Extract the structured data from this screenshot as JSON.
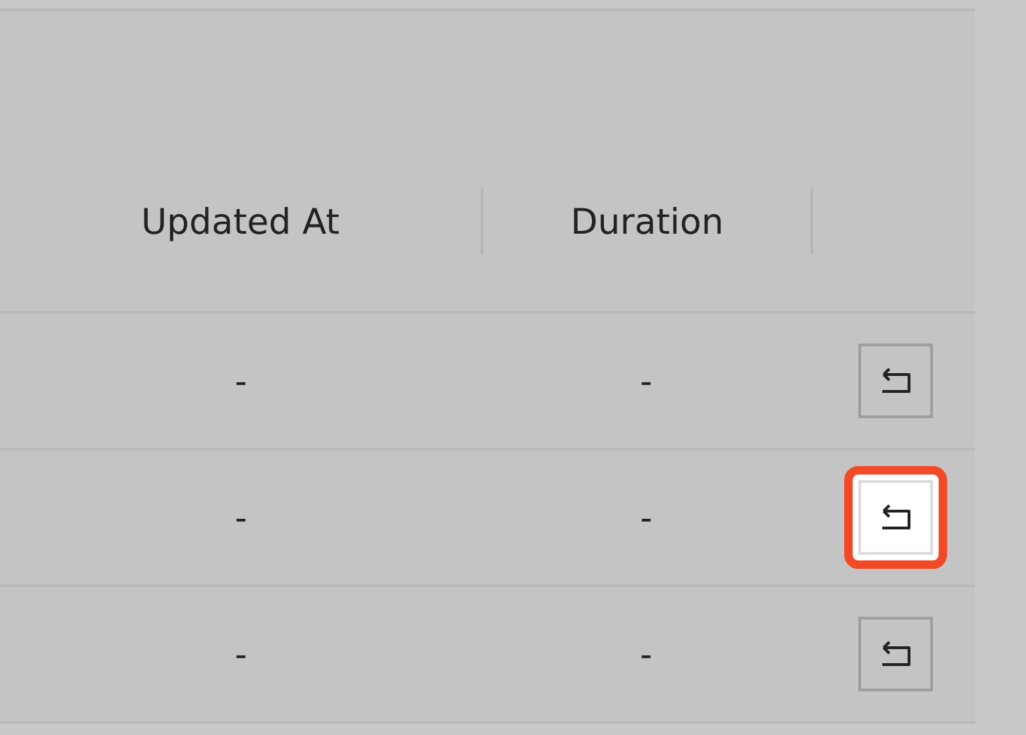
{
  "table": {
    "columns": [
      "Updated At",
      "Duration"
    ],
    "rows": [
      {
        "cells": [
          "-",
          "-"
        ],
        "highlighted": false
      },
      {
        "cells": [
          "-",
          "-"
        ],
        "highlighted": true
      },
      {
        "cells": [
          "-",
          "-"
        ],
        "highlighted": false
      }
    ]
  }
}
